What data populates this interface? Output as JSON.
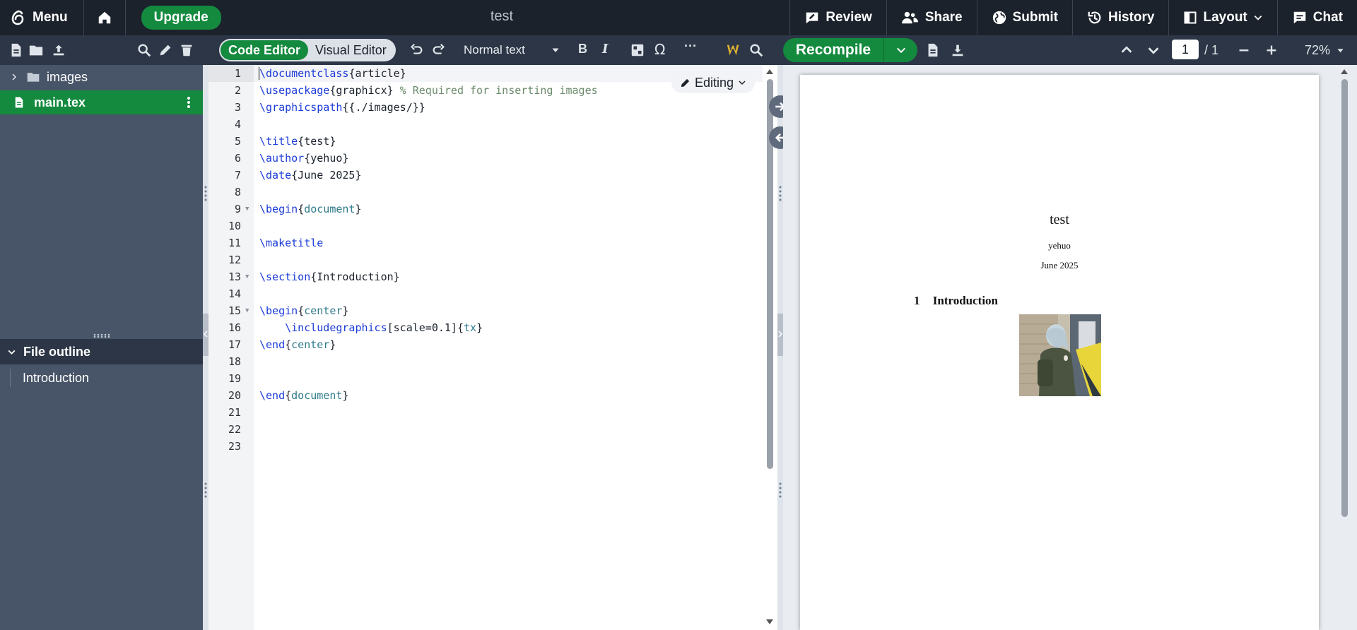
{
  "topbar": {
    "menu_label": "Menu",
    "upgrade_label": "Upgrade",
    "project_title": "test",
    "review_label": "Review",
    "share_label": "Share",
    "submit_label": "Submit",
    "history_label": "History",
    "layout_label": "Layout",
    "chat_label": "Chat"
  },
  "toolbar": {
    "code_editor_label": "Code Editor",
    "visual_editor_label": "Visual Editor",
    "text_style": "Normal text",
    "bold_label": "B",
    "italic_label": "I",
    "symbol_label": "Ω",
    "more_label": "···"
  },
  "pdf_toolbar": {
    "recompile_label": "Recompile",
    "current_page": "1",
    "page_total": "/ 1",
    "zoom": "72%"
  },
  "file_tree": {
    "items": [
      {
        "label": "images",
        "type": "folder"
      },
      {
        "label": "main.tex",
        "type": "file"
      }
    ]
  },
  "outline": {
    "header": "File outline",
    "items": [
      "Introduction"
    ]
  },
  "editor": {
    "mode_badge": "Editing",
    "active_line": 1,
    "line_numbers": [
      "1",
      "2",
      "3",
      "4",
      "5",
      "6",
      "7",
      "8",
      "9",
      "10",
      "11",
      "12",
      "13",
      "14",
      "15",
      "16",
      "17",
      "18",
      "19",
      "20",
      "21",
      "22",
      "23"
    ],
    "tokens": {
      "l1_cmd": "\\documentclass",
      "l1_arg": "{article}",
      "l2_cmd": "\\usepackage",
      "l2_arg": "{graphicx}",
      "l2_comment": " % Required for inserting images",
      "l3_cmd": "\\graphicspath",
      "l3_arg": "{{./images/}}",
      "l5_cmd": "\\title",
      "l5_arg": "{test}",
      "l6_cmd": "\\author",
      "l6_arg": "{yehuo}",
      "l7_cmd": "\\date",
      "l7_arg": "{June 2025}",
      "l9_cmd": "\\begin",
      "l9_open": "{",
      "l9_env": "document",
      "l9_close": "}",
      "l11_cmd": "\\maketitle",
      "l13_cmd": "\\section",
      "l13_arg": "{Introduction}",
      "l15_cmd": "\\begin",
      "l15_open": "{",
      "l15_env": "center",
      "l15_close": "}",
      "l16_indent": "    ",
      "l16_cmd": "\\includegraphics",
      "l16_opt": "[scale=0.1]{",
      "l16_env": "tx",
      "l16_close": "}",
      "l17_cmd": "\\end",
      "l17_open": "{",
      "l17_env": "center",
      "l17_close": "}",
      "l20_cmd": "\\end",
      "l20_open": "{",
      "l20_env": "document",
      "l20_close": "}"
    }
  },
  "pdf": {
    "title": "test",
    "author": "yehuo",
    "date": "June 2025",
    "section_number": "1",
    "section_title": "Introduction"
  },
  "colors": {
    "topbar_bg": "#1b222c",
    "accent_green": "#138a3e",
    "sidebar_bg": "#485568",
    "toolbar_bg": "#2c3646"
  }
}
